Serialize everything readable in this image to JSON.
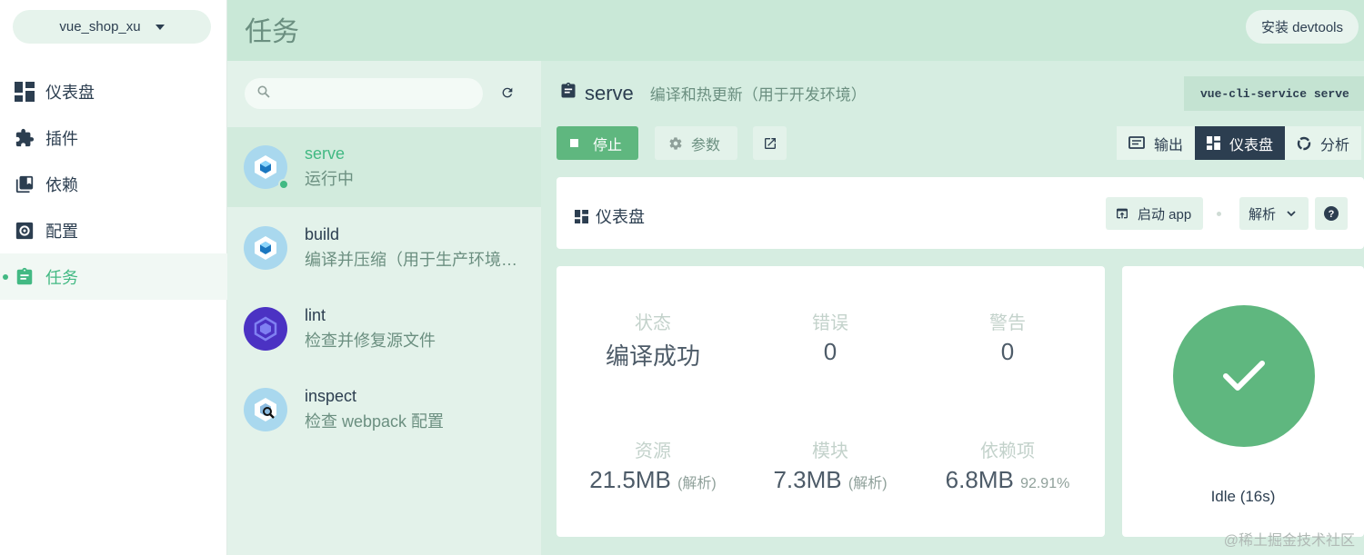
{
  "sidebar": {
    "project": "vue_shop_xu",
    "items": [
      {
        "label": "仪表盘",
        "icon": "dashboard-icon"
      },
      {
        "label": "插件",
        "icon": "puzzle-icon"
      },
      {
        "label": "依赖",
        "icon": "library-icon"
      },
      {
        "label": "配置",
        "icon": "settings-icon"
      },
      {
        "label": "任务",
        "icon": "assignment-icon",
        "active": true
      }
    ]
  },
  "header": {
    "title": "任务",
    "devtools_label": "安装 devtools"
  },
  "tasks": {
    "search_placeholder": "",
    "items": [
      {
        "name": "serve",
        "desc": "运行中",
        "selected": true,
        "icon": "webpack-icon"
      },
      {
        "name": "build",
        "desc": "编译并压缩（用于生产环境…",
        "icon": "webpack-icon"
      },
      {
        "name": "lint",
        "desc": "检查并修复源文件",
        "icon": "eslint-icon"
      },
      {
        "name": "inspect",
        "desc": "检查 webpack 配置",
        "icon": "webpack-inspect-icon"
      }
    ]
  },
  "main": {
    "task_name": "serve",
    "task_desc": "编译和热更新（用于开发环境）",
    "command": "vue-cli-service serve",
    "stop_label": "停止",
    "params_label": "参数",
    "views": [
      {
        "label": "输出",
        "icon": "output-icon"
      },
      {
        "label": "仪表盘",
        "icon": "dashboard-icon",
        "active": true
      },
      {
        "label": "分析",
        "icon": "analyzer-icon"
      }
    ],
    "dashboard_title": "仪表盘",
    "launch_label": "启动 app",
    "analyze_label": "解析",
    "stats": {
      "status_label": "状态",
      "status_value": "编译成功",
      "errors_label": "错误",
      "errors_value": "0",
      "warnings_label": "警告",
      "warnings_value": "0",
      "assets_label": "资源",
      "assets_value": "21.5MB",
      "assets_sub": "(解析)",
      "modules_label": "模块",
      "modules_value": "7.3MB",
      "modules_sub": "(解析)",
      "deps_label": "依赖项",
      "deps_value": "6.8MB",
      "deps_sub": "92.91%"
    },
    "idle_text": "Idle (16s)"
  },
  "watermark": "@稀土掘金技术社区",
  "colors": {
    "accent": "#42b983",
    "header_bg": "#c9e8d7",
    "dark": "#2c3e50"
  }
}
